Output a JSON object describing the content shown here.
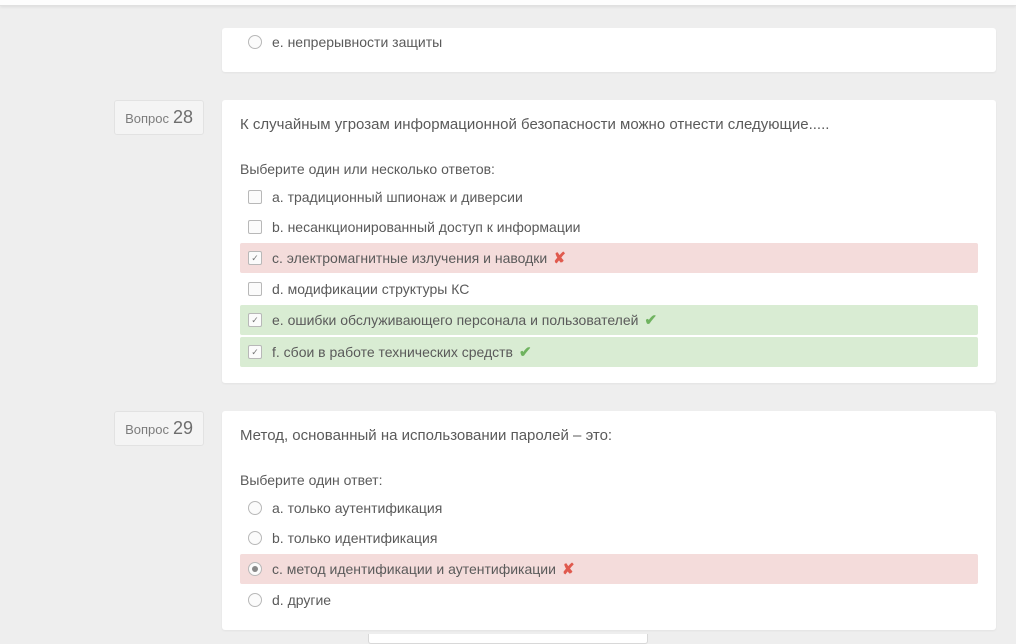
{
  "labels": {
    "question_word": "Вопрос"
  },
  "q_prev": {
    "options": [
      {
        "label": "e. непрерывности защиты",
        "type": "radio",
        "checked": false,
        "state": "plain"
      }
    ]
  },
  "q28": {
    "number": "28",
    "text": "К случайным угрозам информационной безопасности можно отнести следующие.....",
    "instruction": "Выберите один или несколько ответов:",
    "options": [
      {
        "label": "a. традиционный шпионаж и диверсии",
        "type": "checkbox",
        "checked": false,
        "state": "plain"
      },
      {
        "label": "b. несанкционированный доступ к информации",
        "type": "checkbox",
        "checked": false,
        "state": "plain"
      },
      {
        "label": "c. электромагнитные излучения и наводки",
        "type": "checkbox",
        "checked": true,
        "state": "incorrect"
      },
      {
        "label": "d. модификации структуры КС",
        "type": "checkbox",
        "checked": false,
        "state": "plain"
      },
      {
        "label": "e. ошибки обслуживающего персонала и пользователей",
        "type": "checkbox",
        "checked": true,
        "state": "correct"
      },
      {
        "label": "f. сбои в работе технических средств",
        "type": "checkbox",
        "checked": true,
        "state": "correct"
      }
    ]
  },
  "q29": {
    "number": "29",
    "text": "Метод, основанный на использовании паролей – это:",
    "instruction": "Выберите один ответ:",
    "options": [
      {
        "label": "a. только аутентификация",
        "type": "radio",
        "checked": false,
        "state": "plain"
      },
      {
        "label": "b. только идентификация",
        "type": "radio",
        "checked": false,
        "state": "plain"
      },
      {
        "label": "c. метод идентификации и аутентификации",
        "type": "radio",
        "checked": true,
        "state": "incorrect"
      },
      {
        "label": "d. другие",
        "type": "radio",
        "checked": false,
        "state": "plain"
      }
    ]
  }
}
